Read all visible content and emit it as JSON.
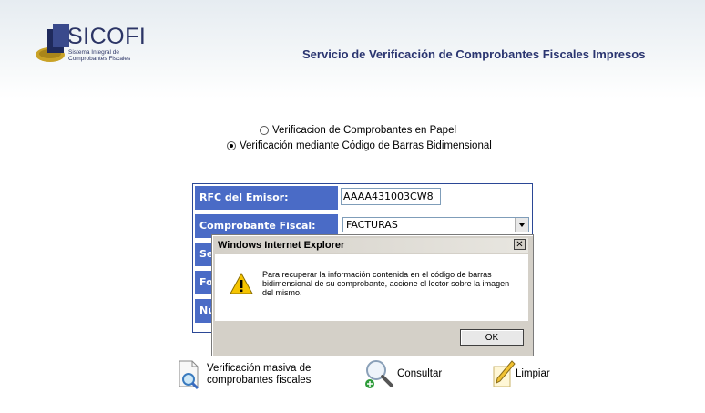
{
  "header": {
    "logo_text": "SICOFI",
    "logo_subtitle": "Sistema Integral de Comprobantes Fiscales",
    "title": "Servicio de Verificación de Comprobantes Fiscales Impresos"
  },
  "verification_mode": {
    "options": [
      {
        "label": "Verificacion de Comprobantes en Papel",
        "checked": false
      },
      {
        "label": "Verificación mediante Código de Barras Bidimensional",
        "checked": true
      }
    ]
  },
  "form": {
    "rfc_label": "RFC del Emisor:",
    "rfc_value": "AAAA431003CW8",
    "comprobante_label": "Comprobante Fiscal:",
    "comprobante_value": "FACTURAS",
    "row3_label": "Se",
    "row4_label": "Fo",
    "row5_label": "Nú"
  },
  "actions": {
    "masiva_label_1": "Verificación masiva de",
    "masiva_label_2": "comprobantes fiscales",
    "consultar_label": "Consultar",
    "limpiar_label": "Limpiar"
  },
  "dialog": {
    "title": "Windows Internet Explorer",
    "close_glyph": "✕",
    "message": "Para recuperar la información contenida en el código de barras bidimensional de su comprobante, accione el lector sobre la imagen del mismo.",
    "ok_label": "OK"
  }
}
